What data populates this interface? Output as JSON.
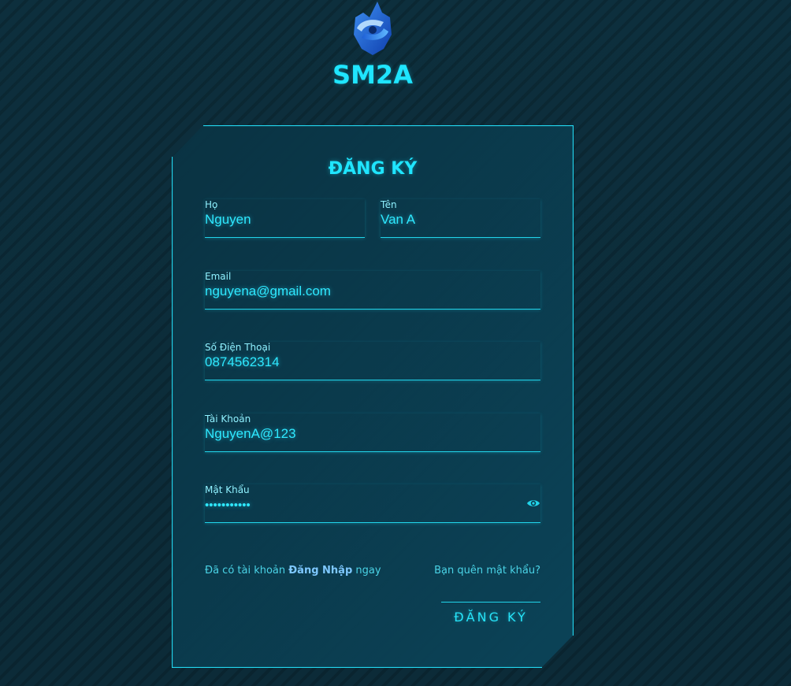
{
  "brand": {
    "name": "SM2A",
    "logo_icon": "sm2a-logo-icon"
  },
  "form": {
    "title": "ĐĂNG KÝ",
    "fields": {
      "last_name": {
        "label": "Họ",
        "value": "Nguyen"
      },
      "first_name": {
        "label": "Tên",
        "value": "Van A"
      },
      "email": {
        "label": "Email",
        "value": "nguyena@gmail.com"
      },
      "phone": {
        "label": "Số Điện Thoại",
        "value": "0874562314"
      },
      "username": {
        "label": "Tài Khoản",
        "value": "NguyenA@123"
      },
      "password": {
        "label": "Mật Khẩu",
        "value": "•••••••••••",
        "toggle_icon": "eye-icon"
      }
    },
    "have_account_prefix": "Đã có tài khoản",
    "login_link": "Đăng Nhập",
    "have_account_suffix": "ngay",
    "forgot_password": "Bạn quên mật khẩu?",
    "submit_label": "ĐĂNG KÝ"
  },
  "colors": {
    "accent": "#1fe5ff",
    "background": "#0b2a37",
    "card": "#0b3a4c",
    "link": "#7ec8ff"
  }
}
